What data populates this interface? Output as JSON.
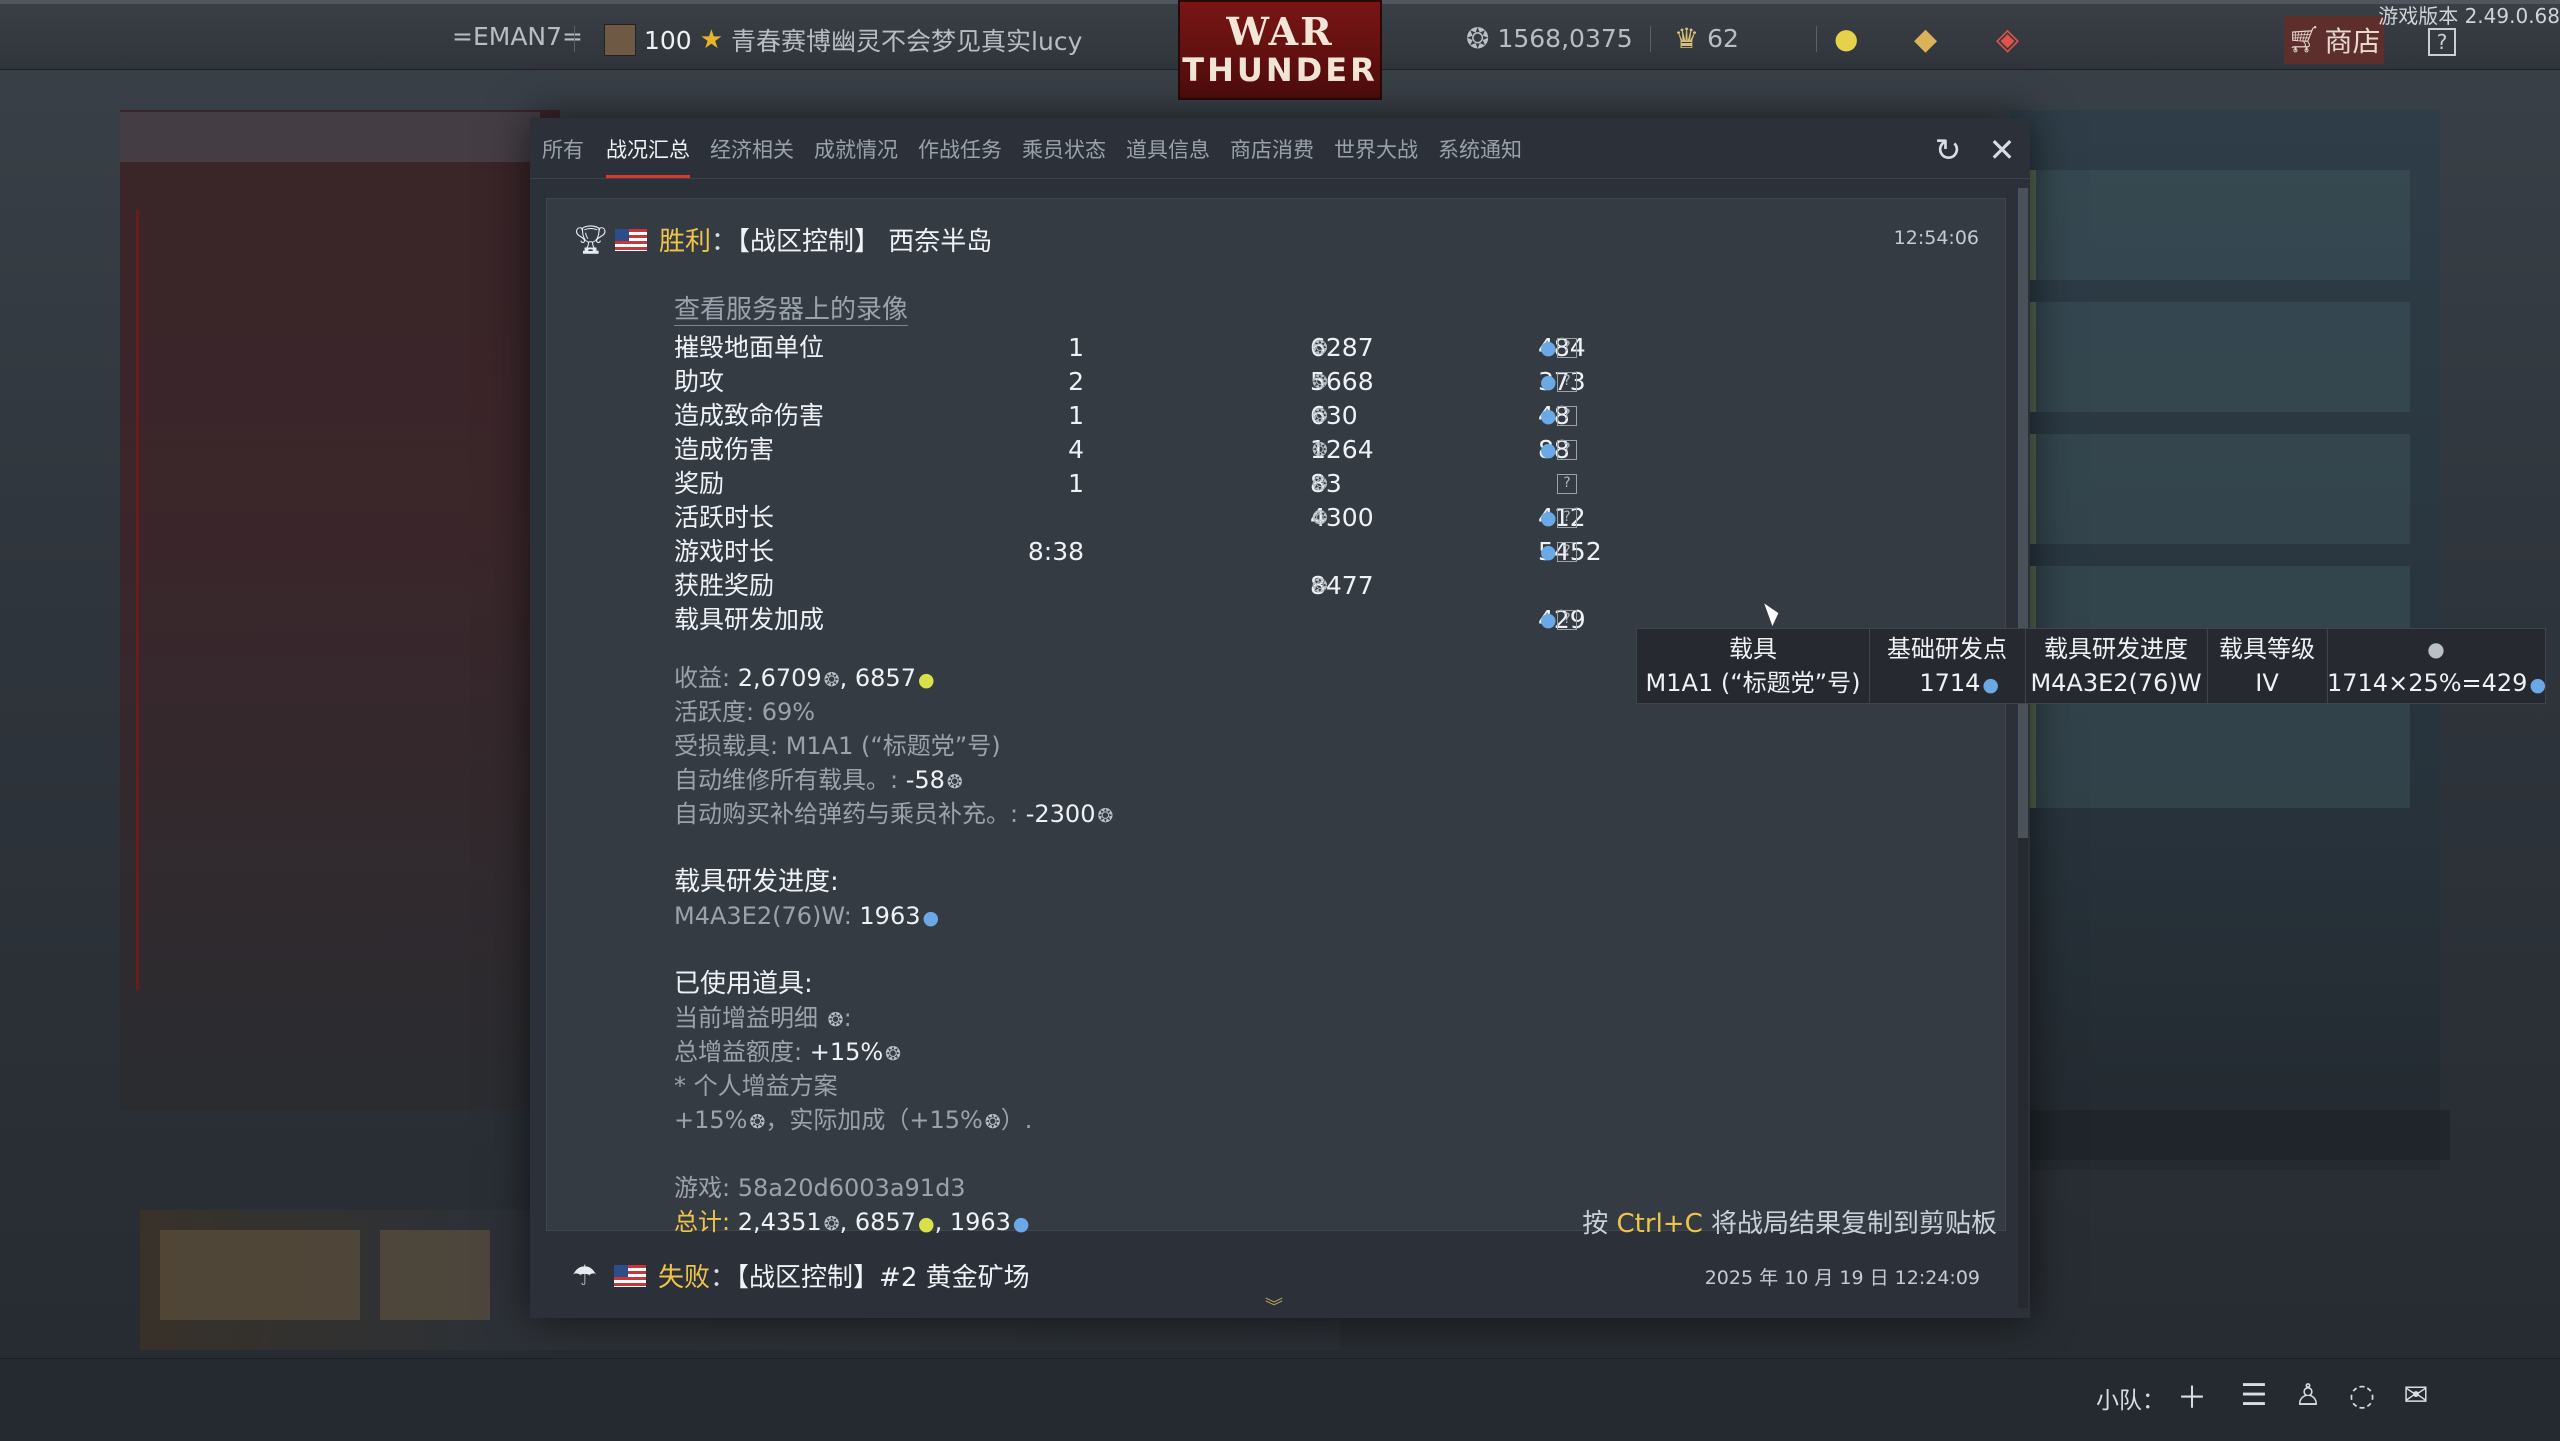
{
  "topbar": {
    "squad_tag": "=EMAN7=",
    "player_level": "100",
    "player_name": "青春赛博幽灵不会梦见真实lucy",
    "logo_line1": "WAR",
    "logo_line2": "THUNDER",
    "silver_lions": "1568,0375",
    "eagles": "62",
    "shop_label": "商店",
    "help_label": "?",
    "version": "游戏版本 2.49.0.68"
  },
  "tabs": [
    "所有",
    "战况汇总",
    "经济相关",
    "成就情况",
    "作战任务",
    "乘员状态",
    "道具信息",
    "商店消费",
    "世界大战",
    "系统通知"
  ],
  "active_tab": "战况汇总",
  "entry": {
    "result": "胜利",
    "separator": "：",
    "mission": "【战区控制】 西奈半岛",
    "time": "12:54:06",
    "replay_link": "查看服务器上的录像",
    "rows": [
      {
        "label": "摧毁地面单位",
        "count": "1",
        "sl": "6287",
        "rp": "484",
        "help": "?"
      },
      {
        "label": "助攻",
        "count": "2",
        "sl": "5668",
        "rp": "373",
        "help": "?"
      },
      {
        "label": "造成致命伤害",
        "count": "1",
        "sl": "630",
        "rp": "48",
        "help": "?"
      },
      {
        "label": "造成伤害",
        "count": "4",
        "sl": "1264",
        "rp": "88",
        "help": "?"
      },
      {
        "label": "奖励",
        "count": "1",
        "sl": "83",
        "rp": "",
        "help": "?"
      },
      {
        "label": "活跃时长",
        "count": "",
        "sl": "4300",
        "rp": "412",
        "help": "?"
      },
      {
        "label": "游戏时长",
        "count": "8:38",
        "sl": "",
        "rp": "5452",
        "help": "?"
      },
      {
        "label": "获胜奖励",
        "count": "",
        "sl": "8477",
        "rp": "",
        "help": ""
      },
      {
        "label": "载具研发加成",
        "count": "",
        "sl": "",
        "rp": "429",
        "help": "?"
      }
    ],
    "income_label": "收益: ",
    "income_sl": "2,6709",
    "income_gold": "6857",
    "activity_label": "活跃度: ",
    "activity_value": "69%",
    "damaged_label": "受损载具: ",
    "damaged_value": "M1A1 (“标题党”号)",
    "repair_label": "自动维修所有载具。: ",
    "repair_value": "-58",
    "resupply_label": "自动购买补给弹药与乘员补充。: ",
    "resupply_value": "-2300",
    "research_header": "载具研发进度:",
    "research_vehicle": "M4A3E2(76)W: ",
    "research_value": "1963",
    "items_header": "已使用道具:",
    "boost_detail": "当前增益明细",
    "boost_total_label": "总增益额度: ",
    "boost_total_value": "+15%",
    "personal_boost": "* 个人增益方案",
    "boost_line": "+15%",
    "boost_actual": "，实际加成（+15%",
    "boost_actual_end": "）.",
    "game_label": "游戏: ",
    "game_id": "58a20d6003a91d3",
    "total_label": "总计: ",
    "total_sl": "2,4351",
    "total_gold": "6857",
    "total_rp": "1963",
    "copy_hint_pre": "按 ",
    "copy_hint_key": "Ctrl+C",
    "copy_hint_post": " 将战局结果复制到剪贴板"
  },
  "entry2": {
    "result": "失败",
    "separator": "：",
    "mission": "【战区控制】#2 黄金矿场",
    "time": "2025 年 10 月 19 日 12:24:09"
  },
  "tooltip": {
    "headers": [
      "载具",
      "基础研发点",
      "载具研发进度",
      "载具等级",
      ""
    ],
    "values": [
      "M1A1 (“标题党”号)",
      "1714",
      "M4A3E2(76)W",
      "IV",
      "1714×25%=429"
    ]
  },
  "bottombar": {
    "squad_label": "小队："
  },
  "icons": {
    "silver": "silver-lion-icon",
    "rp": "research-point-icon",
    "gold": "golden-eagle-icon"
  },
  "colors": {
    "accent_red": "#d7392f",
    "win_gold": "#f0c44a",
    "rp_blue": "#6aa9e6",
    "gold_yellow": "#d7e24a"
  }
}
